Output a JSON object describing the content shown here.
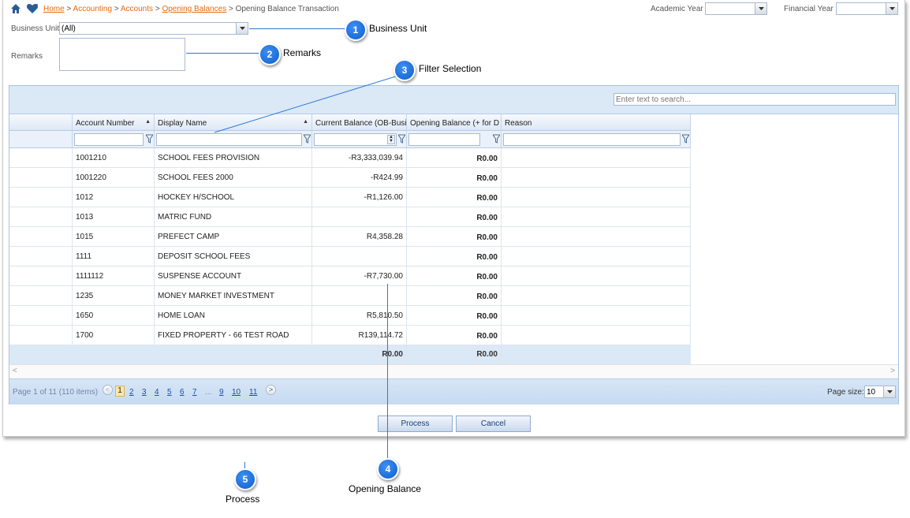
{
  "breadcrumb": {
    "items": [
      "Home",
      "Accounting",
      "Accounts",
      "Opening Balances"
    ],
    "separator": ">",
    "current": "Opening Balance Transaction"
  },
  "header": {
    "academic_year_label": "Academic Year",
    "academic_year_value": "",
    "financial_year_label": "Financial Year",
    "financial_year_value": ""
  },
  "form": {
    "business_unit_label": "Business Unit",
    "business_unit_value": "(All)",
    "remarks_label": "Remarks",
    "remarks_value": ""
  },
  "grid": {
    "search_placeholder": "Enter text to search...",
    "columns": [
      "",
      "Account Number",
      "Display Name",
      "Current Balance (OB-Busi",
      "Opening Balance (+ for D",
      "Reason"
    ],
    "rows": [
      {
        "account": "1001210",
        "name": "SCHOOL FEES PROVISION",
        "current": "-R3,333,039.94",
        "opening": "R0.00",
        "reason": ""
      },
      {
        "account": "1001220",
        "name": "SCHOOL FEES 2000",
        "current": "-R424.99",
        "opening": "R0.00",
        "reason": ""
      },
      {
        "account": "1012",
        "name": "HOCKEY H/SCHOOL",
        "current": "-R1,126.00",
        "opening": "R0.00",
        "reason": ""
      },
      {
        "account": "1013",
        "name": "MATRIC FUND",
        "current": "",
        "opening": "R0.00",
        "reason": ""
      },
      {
        "account": "1015",
        "name": "PREFECT CAMP",
        "current": "R4,358.28",
        "opening": "R0.00",
        "reason": ""
      },
      {
        "account": "1111",
        "name": "DEPOSIT SCHOOL FEES",
        "current": "",
        "opening": "R0.00",
        "reason": ""
      },
      {
        "account": "1111112",
        "name": "SUSPENSE ACCOUNT",
        "current": "-R7,730.00",
        "opening": "R0.00",
        "reason": ""
      },
      {
        "account": "1235",
        "name": "MONEY MARKET INVESTMENT",
        "current": "",
        "opening": "R0.00",
        "reason": ""
      },
      {
        "account": "1650",
        "name": "HOME LOAN",
        "current": "R5,810.50",
        "opening": "R0.00",
        "reason": ""
      },
      {
        "account": "1700",
        "name": "FIXED PROPERTY - 66 TEST ROAD",
        "current": "R139,114.72",
        "opening": "R0.00",
        "reason": ""
      }
    ],
    "footer_current": "R0.00",
    "footer_opening": "R0.00"
  },
  "pager": {
    "info": "Page 1 of 11 (110 items)",
    "current_page": "1",
    "pages": [
      "2",
      "3",
      "4",
      "5",
      "6",
      "7"
    ],
    "ellipsis": "...",
    "tail_pages": [
      "9",
      "10",
      "11"
    ],
    "page_size_label": "Page size:",
    "page_size_value": "10"
  },
  "buttons": {
    "process": "Process",
    "cancel": "Cancel"
  },
  "callouts": [
    {
      "number": "1",
      "label": "Business Unit"
    },
    {
      "number": "2",
      "label": "Remarks"
    },
    {
      "number": "3",
      "label": "Filter Selection"
    },
    {
      "number": "4",
      "label": "Opening Balance"
    },
    {
      "number": "5",
      "label": "Process"
    }
  ],
  "colors": {
    "link": "#e06b10",
    "grid_header": "#dbe8f6",
    "callout": "#1a73e0",
    "pager_link": "#2050a0"
  }
}
